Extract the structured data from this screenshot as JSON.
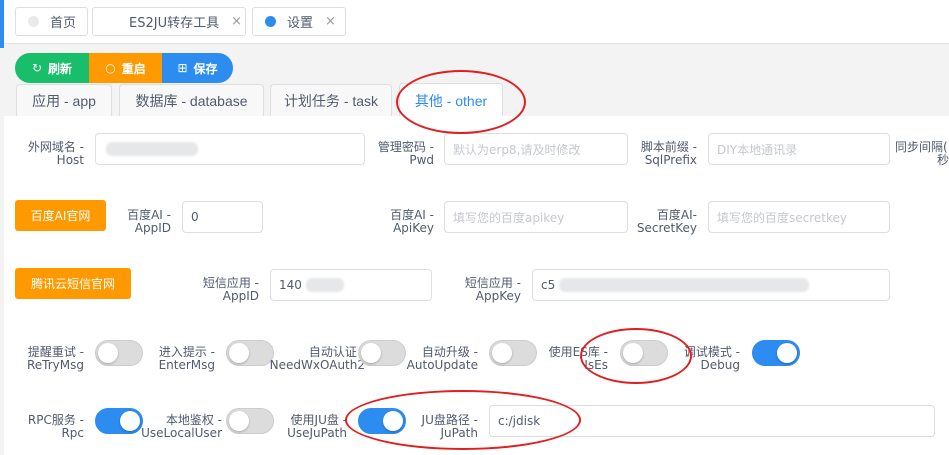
{
  "page_tabs": [
    {
      "label": "首页",
      "active": false,
      "closable": false
    },
    {
      "label": "ES2JU转存工具",
      "active": false,
      "closable": true
    },
    {
      "label": "设置",
      "active": true,
      "closable": true
    }
  ],
  "tab_close_glyph": "×",
  "actions": {
    "refresh_icon": "↻",
    "refresh": "刷新",
    "restart_icon": "○",
    "restart": "重启",
    "save_icon": "⊞",
    "save": "保存"
  },
  "section_tabs": [
    {
      "label": "应用 - app",
      "active": false
    },
    {
      "label": "数据库 - database",
      "active": false
    },
    {
      "label": "计划任务 - task",
      "active": false
    },
    {
      "label": "其他 - other",
      "active": true
    }
  ],
  "row1": {
    "host_label_1": "外网域名 -",
    "host_label_2": "Host",
    "host_value": "",
    "pwd_label_1": "管理密码 -",
    "pwd_label_2": "Pwd",
    "pwd_placeholder": "默认为erp8,请及时修改",
    "sqlprefix_label_1": "脚本前缀 -",
    "sqlprefix_label_2": "SqlPrefix",
    "sqlprefix_placeholder": "DIY本地通讯录",
    "sync_label_1": "同步间隔(",
    "sync_label_2": "秒"
  },
  "row2": {
    "baidu_button": "百度AI官网",
    "appid_label_1": "百度AI -",
    "appid_label_2": "AppID",
    "appid_value": "0",
    "apikey_label_1": "百度AI -",
    "apikey_label_2": "ApiKey",
    "apikey_placeholder": "填写您的百度apikey",
    "secret_label_1": "百度AI-",
    "secret_label_2": "SecretKey",
    "secret_placeholder": "填写您的百度secretkey"
  },
  "row3": {
    "tencent_button": "腾讯云短信官网",
    "sms_appid_label_1": "短信应用 -",
    "sms_appid_label_2": "AppID",
    "sms_appid_value": "140",
    "sms_appkey_label_1": "短信应用 -",
    "sms_appkey_label_2": "AppKey",
    "sms_appkey_value": "c5"
  },
  "row4": [
    {
      "l1": "提醒重试 -",
      "l2": "ReTryMsg",
      "on": false
    },
    {
      "l1": "进入提示 -",
      "l2": "EnterMsg",
      "on": false
    },
    {
      "l1": "自动认证 -",
      "l2": "NeedWxOAuth2",
      "on": false
    },
    {
      "l1": "自动升级 -",
      "l2": "AutoUpdate",
      "on": false
    },
    {
      "l1": "使用ES库 -",
      "l2": "IsEs",
      "on": false
    },
    {
      "l1": "调试模式 -",
      "l2": "Debug",
      "on": true
    }
  ],
  "row5": {
    "switches": [
      {
        "l1": "RPC服务 -",
        "l2": "Rpc",
        "on": true
      },
      {
        "l1": "本地鉴权 -",
        "l2": "UseLocalUser",
        "on": false
      },
      {
        "l1": "使用JU盘 -",
        "l2": "UseJuPath",
        "on": true
      }
    ],
    "jupath_label_1": "JU盘路径 -",
    "jupath_label_2": "JuPath",
    "jupath_value": "c:/jdisk"
  },
  "colors": {
    "success": "#19be6b",
    "warning": "#ff9900",
    "primary": "#2d8cf0",
    "annotation": "#e02020"
  }
}
